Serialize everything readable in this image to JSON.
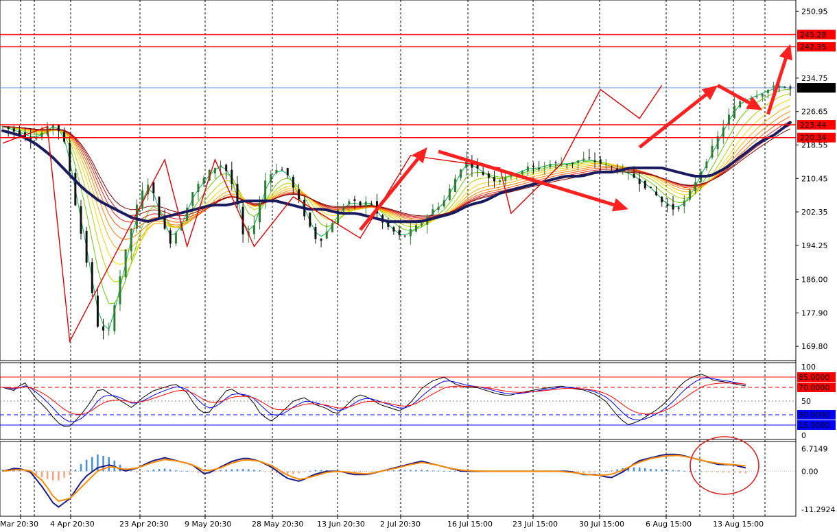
{
  "chart_data": {
    "type": "line",
    "colors": {
      "background": "#ffffff",
      "bull": "#2e7d32",
      "bear": "#111111",
      "level": "#ff0000",
      "oversold": "#0000ff",
      "trend_ma": "#1a1a5e",
      "signal": "#ff8c00",
      "hist_up": "#4a90e2",
      "hist_down": "#f4a582"
    },
    "x_labels": [
      "Mar 20:30",
      "4 Apr 20:30",
      "23 Apr 20:30",
      "9 May 20:30",
      "28 May 20:30",
      "13 Jun 20:30",
      "2 Jul 20:30",
      "16 Jul 15:00",
      "23 Jul 15:00",
      "30 Jul 15:00",
      "6 Aug 15:00",
      "13 Aug 15:00"
    ],
    "grid": true,
    "price_panel": {
      "y_ticks": [
        "250.95",
        "234.75",
        "226.65",
        "218.55",
        "210.45",
        "202.35",
        "194.25",
        "186.00",
        "177.90",
        "169.80"
      ],
      "ylim": [
        167,
        253
      ],
      "levels": [
        {
          "value": 245.28,
          "label": "245.28"
        },
        {
          "value": 242.35,
          "label": "242.35"
        },
        {
          "value": 223.44,
          "label": "223.44"
        },
        {
          "value": 220.34,
          "label": "220.34"
        }
      ],
      "current": {
        "value": 232.41,
        "label": "232.41"
      },
      "close_path": [
        223,
        222,
        221,
        220,
        222,
        224,
        218,
        203,
        190,
        175,
        172,
        185,
        196,
        206,
        210,
        200,
        195,
        200,
        207,
        210,
        213,
        214,
        208,
        195,
        200,
        210,
        213,
        212,
        206,
        200,
        195,
        198,
        203,
        205,
        204,
        205,
        200,
        198,
        196,
        198,
        200,
        203,
        205,
        210,
        215,
        213,
        211,
        210,
        211,
        212,
        213,
        213,
        214,
        214,
        214,
        215,
        215,
        214,
        213,
        212,
        211,
        209,
        207,
        204,
        203,
        205,
        210,
        215,
        220,
        225,
        229,
        230,
        231,
        232,
        233,
        232
      ],
      "trend_ma": [
        222,
        221,
        219,
        216,
        212,
        208,
        205,
        203,
        201,
        200,
        201,
        202,
        203,
        204,
        204,
        205,
        205,
        205,
        204,
        203,
        203,
        202,
        202,
        201,
        200,
        200,
        200,
        201,
        202,
        204,
        205,
        207,
        208,
        209,
        210,
        211,
        211,
        212,
        212,
        213,
        213,
        213,
        212,
        211,
        211,
        213,
        216,
        219,
        221,
        224
      ],
      "zigzag": [
        [
          0,
          219
        ],
        [
          8,
          223
        ],
        [
          12,
          171
        ],
        [
          29,
          215
        ],
        [
          33,
          194
        ],
        [
          38,
          215
        ],
        [
          45,
          194
        ],
        [
          52,
          206
        ],
        [
          64,
          196
        ],
        [
          73,
          216
        ],
        [
          89,
          213
        ],
        [
          91,
          202
        ],
        [
          100,
          214
        ],
        [
          107,
          232
        ],
        [
          114,
          225
        ],
        [
          118,
          233
        ]
      ],
      "arrows": [
        {
          "from": [
            64,
            198
          ],
          "to": [
            76,
            218
          ]
        },
        {
          "from": [
            78,
            217
          ],
          "to": [
            112,
            203
          ]
        },
        {
          "from": [
            114,
            218
          ],
          "to": [
            128,
            233
          ]
        },
        {
          "from": [
            128,
            233
          ],
          "to": [
            136,
            227
          ]
        },
        {
          "from": [
            137,
            226
          ],
          "to": [
            141,
            243
          ]
        }
      ]
    },
    "oscillator_panel": {
      "y_ticks": [
        "100",
        "50",
        "0"
      ],
      "ylim": [
        0,
        100
      ],
      "levels": [
        {
          "value": 85,
          "label": "85.0000",
          "color": "red",
          "dash": "solid"
        },
        {
          "value": 70,
          "label": "70.0000",
          "color": "red",
          "dash": "dash"
        },
        {
          "value": 30,
          "label": "30.0000",
          "color": "blue",
          "dash": "dash"
        },
        {
          "value": 15,
          "label": "15.0000",
          "color": "blue",
          "dash": "solid"
        }
      ],
      "fast": [
        70,
        65,
        78,
        55,
        40,
        20,
        10,
        25,
        45,
        70,
        60,
        50,
        40,
        55,
        65,
        70,
        75,
        65,
        40,
        30,
        50,
        70,
        60,
        55,
        30,
        20,
        35,
        50,
        55,
        45,
        40,
        30,
        45,
        60,
        55,
        45,
        40,
        35,
        50,
        70,
        80,
        85,
        75,
        70,
        70,
        65,
        60,
        58,
        62,
        65,
        68,
        70,
        72,
        68,
        66,
        60,
        50,
        30,
        15,
        20,
        30,
        40,
        55,
        75,
        85,
        90,
        80,
        78,
        75,
        72
      ]
    },
    "macd_panel": {
      "y_ticks": [
        "6.7149",
        "0.00",
        "-11.2924"
      ],
      "ylim": [
        -12.5,
        8
      ],
      "macd": [
        0,
        1,
        0,
        -5,
        -11,
        -8,
        -2,
        1,
        2,
        0,
        1,
        3,
        4,
        3,
        2,
        -1,
        1,
        3,
        4,
        3,
        1,
        -2,
        -3,
        -1,
        0,
        0,
        -1,
        -1,
        0,
        1,
        2,
        3,
        2,
        1,
        0,
        0,
        0,
        0,
        0,
        0,
        0,
        0,
        0,
        -1,
        -1,
        -2,
        0,
        3,
        4,
        5,
        5,
        4,
        3,
        2,
        2,
        1
      ],
      "signal": [
        0,
        0.5,
        0.3,
        -3,
        -9,
        -8,
        -4,
        0,
        1.5,
        0.5,
        1,
        2.5,
        3.5,
        3,
        2,
        0,
        0.8,
        2.5,
        3.5,
        3,
        1.5,
        -1,
        -2.5,
        -1.5,
        -0.3,
        0,
        -0.5,
        -0.8,
        0,
        0.8,
        1.8,
        2.6,
        2,
        1,
        0.3,
        0.1,
        0,
        0,
        0,
        0,
        0,
        0,
        -0.3,
        -0.8,
        -1.2,
        -1,
        0.5,
        2.5,
        3.8,
        4.5,
        4.7,
        4,
        3,
        2.3,
        2,
        1.6
      ],
      "hist": [
        0.5,
        0.8,
        -0.5,
        -2,
        -3,
        -1,
        3,
        5,
        4,
        1,
        -0.5,
        0.5,
        0.8,
        0.2,
        0,
        -1,
        0.3,
        0.6,
        0.7,
        0.3,
        -0.4,
        -1,
        -0.6,
        0.4,
        0.3,
        0,
        -0.4,
        -0.2,
        0.1,
        0.3,
        0.4,
        0.4,
        0.2,
        0.1,
        0,
        0,
        0,
        0,
        0,
        0,
        0,
        0,
        -0.4,
        -0.5,
        -0.3,
        0.2,
        1,
        1.2,
        0.7,
        0.5,
        0.3,
        0,
        0,
        -0.3,
        -0.4,
        -0.6
      ]
    }
  }
}
